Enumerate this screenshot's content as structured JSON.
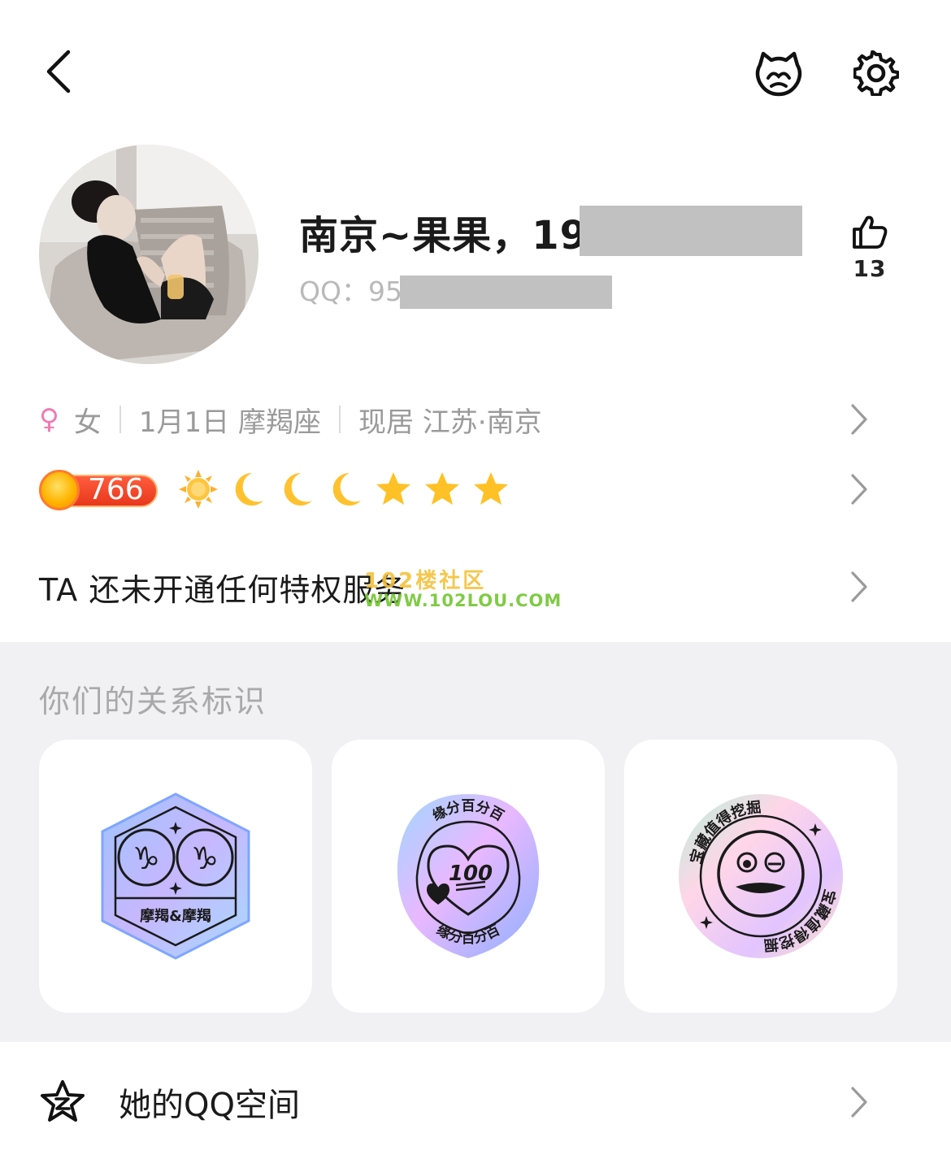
{
  "header": {
    "back_icon": "chevron-left-icon",
    "pet_icon": "pet-face-icon",
    "settings_icon": "gear-icon"
  },
  "profile": {
    "nickname": "南京~果果，199",
    "qq_label": "QQ：95",
    "likes": "13"
  },
  "info": {
    "gender": "女",
    "birthday": "1月1日 摩羯座",
    "location": "现居 江苏·南京"
  },
  "level": {
    "value": "766",
    "icons": [
      "sun",
      "moon",
      "moon",
      "moon",
      "star",
      "star",
      "star"
    ]
  },
  "privilege": {
    "text": "TA 还未开通任何特权服务"
  },
  "watermark": {
    "line1": "102楼社区",
    "line2": "WWW.102LOU.COM"
  },
  "relationship": {
    "title": "你们的关系标识",
    "badges": [
      {
        "caption": "摩羯&摩羯",
        "icon": "capricorn-badge-icon"
      },
      {
        "arc_top": "缘分百分百",
        "arc_bottom": "缘分百分百",
        "mark": "100",
        "icon": "heart-100-badge-icon"
      },
      {
        "arc_top": "宝藏值得挖掘",
        "arc_bottom": "宝藏值得挖掘",
        "icon": "treasure-face-badge-icon"
      }
    ]
  },
  "qzone": {
    "label": "她的QQ空间"
  },
  "colors": {
    "female": "#f07ab5",
    "section_bg": "#f1f1f4",
    "level_pill": "#e8371c",
    "watermark_yellow": "#f4c23a",
    "watermark_green": "#7ac93b"
  }
}
